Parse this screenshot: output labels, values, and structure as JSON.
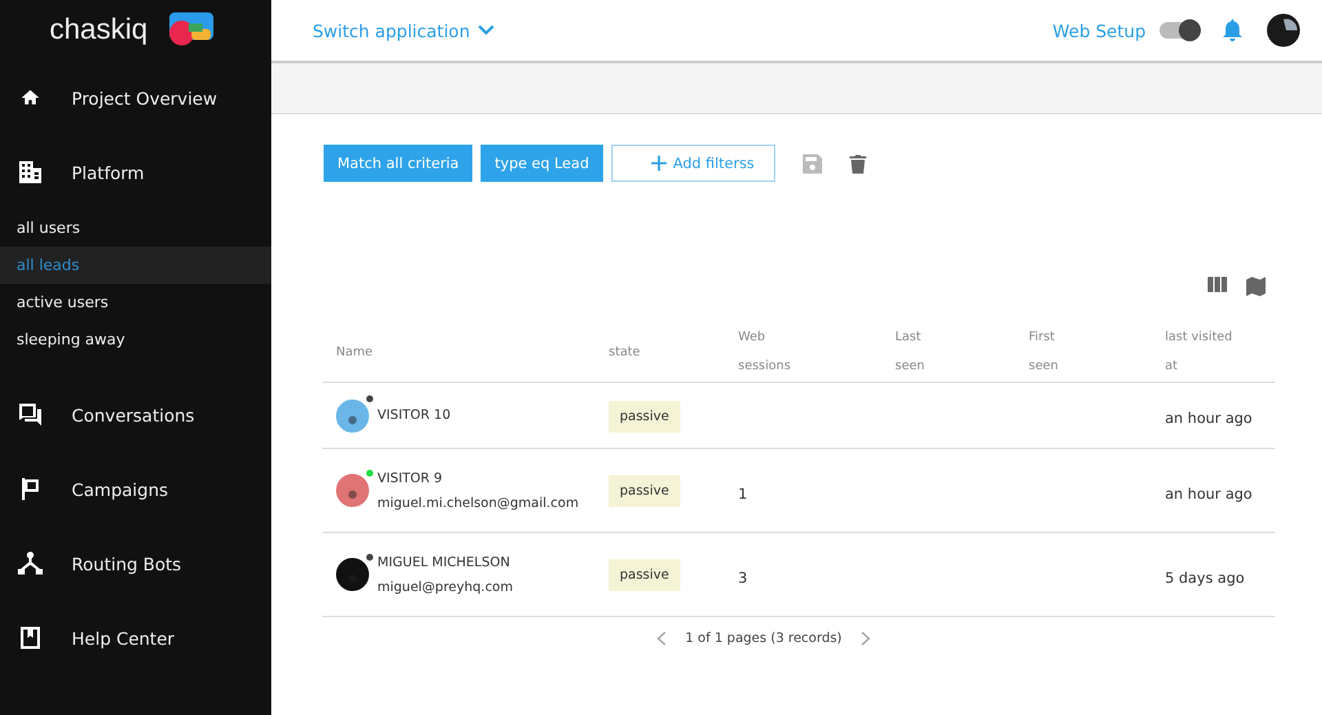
{
  "sidebar": {
    "logo": "chaskiq",
    "items": [
      {
        "kind": "nav",
        "label": "Project Overview"
      },
      {
        "kind": "nav",
        "label": "Platform"
      },
      {
        "kind": "sub",
        "label": "all users",
        "selected": false
      },
      {
        "kind": "sub",
        "label": "all leads",
        "selected": true
      },
      {
        "kind": "sub",
        "label": "active users",
        "selected": false
      },
      {
        "kind": "sub",
        "label": "sleeping away",
        "selected": false
      },
      {
        "kind": "nav",
        "label": "Conversations"
      },
      {
        "kind": "nav",
        "label": "Campaigns"
      },
      {
        "kind": "nav",
        "label": "Routing Bots"
      },
      {
        "kind": "nav",
        "label": "Help Center"
      }
    ]
  },
  "topbar": {
    "switcher": "Switch application",
    "web_setup": {
      "label": "Web Setup",
      "on": true
    }
  },
  "filters": {
    "buttons": [
      "Match all criteria",
      "type eq Lead"
    ],
    "add": "Add filterss"
  },
  "table": {
    "columns": [
      [
        "Name"
      ],
      [
        "state"
      ],
      [
        "Web",
        "sessions"
      ],
      [
        "Last",
        "seen"
      ],
      [
        "First",
        "seen"
      ],
      [
        "last visited",
        "at"
      ]
    ],
    "rows": [
      {
        "name": "VISITOR 10",
        "online": false,
        "color": "#6ab6e8",
        "state": "passive",
        "last_visited": "an hour ago"
      },
      {
        "name": "VISITOR 9",
        "email": "miguel.mi.chelson@gmail.com",
        "online": true,
        "color": "#e07474",
        "state": "passive",
        "sessions": "1",
        "last_visited": "an hour ago"
      },
      {
        "name": "MIGUEL MICHELSON",
        "email": "miguel@preyhq.com",
        "online": false,
        "color": "#111111",
        "state": "passive",
        "sessions": "3",
        "last_visited": "5 days ago"
      }
    ]
  },
  "pagination": "1 of 1 pages (3 records)"
}
